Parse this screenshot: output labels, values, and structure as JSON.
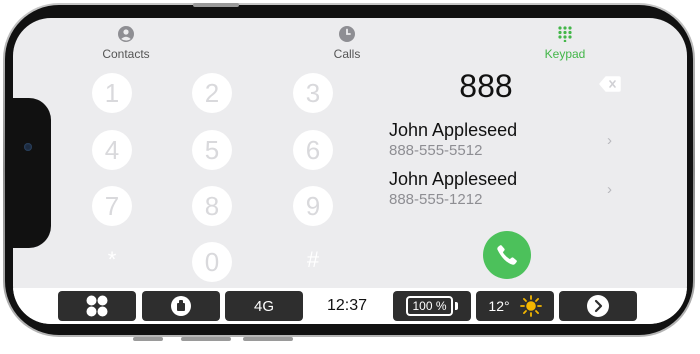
{
  "tabs": [
    {
      "label": "Contacts",
      "icon": "person-circle-icon",
      "active": false
    },
    {
      "label": "Calls",
      "icon": "clock-icon",
      "active": false
    },
    {
      "label": "Keypad",
      "icon": "keypad-grid-icon",
      "active": true
    }
  ],
  "keypad": {
    "keys": [
      "1",
      "2",
      "3",
      "4",
      "5",
      "6",
      "7",
      "8",
      "9",
      "*",
      "0",
      "#"
    ]
  },
  "dial": {
    "number": "888",
    "results": [
      {
        "name": "John Appleseed",
        "phone": "888-555-5512"
      },
      {
        "name": "John Appleseed",
        "phone": "888-555-1212"
      }
    ]
  },
  "dock": {
    "network": "4G",
    "time": "12:37",
    "battery": "100 %",
    "temperature": "12°",
    "icons": [
      "dashboard-icon",
      "app-icon",
      "sun-icon",
      "forward-icon"
    ]
  },
  "colors": {
    "accent_green": "#4cc15b",
    "screen_bg": "#ececee",
    "dock_button": "#2e2e2e"
  }
}
